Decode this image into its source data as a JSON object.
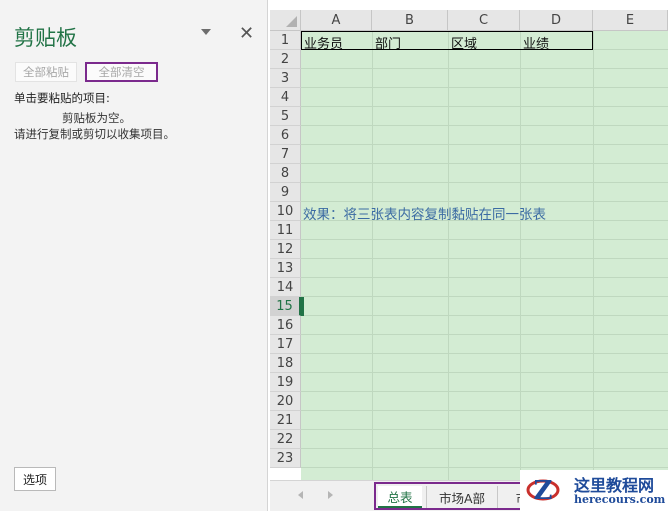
{
  "clipboard_pane": {
    "title": "剪贴板",
    "paste_all_label": "全部粘贴",
    "clear_all_label": "全部清空",
    "instruction": "单击要粘贴的项目:",
    "empty_line1": "剪贴板为空。",
    "empty_line2": "请进行复制或剪切以收集项目。",
    "options_label": "选项"
  },
  "sheet": {
    "columns": [
      "A",
      "B",
      "C",
      "D",
      "E"
    ],
    "rows": [
      "1",
      "2",
      "3",
      "4",
      "5",
      "6",
      "7",
      "8",
      "9",
      "10",
      "11",
      "12",
      "13",
      "14",
      "15",
      "16",
      "17",
      "18",
      "19",
      "20",
      "21",
      "22",
      "23"
    ],
    "active_row": "15",
    "header_cells": [
      "业务员",
      "部门",
      "区域",
      "业绩"
    ],
    "note": "效果：将三张表内容复制黏贴在同一张表",
    "grid_fill": "#d3ecd3",
    "accent": "#217346"
  },
  "tabs": [
    {
      "label": "总表"
    },
    {
      "label": "市场A部"
    },
    {
      "label": "市"
    }
  ],
  "watermark": {
    "title": "这里教程网",
    "url": "herecours.com"
  }
}
